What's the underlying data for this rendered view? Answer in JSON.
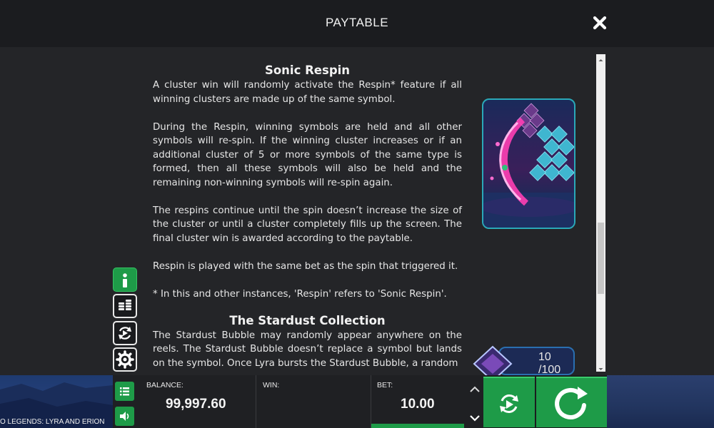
{
  "header": {
    "title": "PAYTABLE"
  },
  "paytable": {
    "section1": {
      "title": "Sonic Respin",
      "paragraphs": [
        "A cluster win will randomly activate the Respin* feature if all winning clusters are made up of the same symbol.",
        "During the Respin, winning symbols are held and all other symbols will re-spin. If the winning cluster increases or if an additional cluster of 5 or more symbols of the same type is formed, then all these symbols will also be held and the remaining non-winning symbols will re-spin again.",
        "The respins continue until the spin doesn’t increase the size of the cluster or until a cluster completely fills up the screen. The final cluster win is awarded according to the paytable.",
        "Respin is played with the same bet as the spin that triggered it.",
        "* In this and other instances, 'Respin' refers to 'Sonic Respin'."
      ]
    },
    "section2": {
      "title": "The Stardust Collection",
      "paragraphs": [
        "The Stardust Bubble may randomly appear anywhere on the reels. The Stardust Bubble doesn’t replace a symbol but lands on the symbol. Once Lyra bursts the Stardust Bubble, a random"
      ]
    },
    "counter": {
      "text": "10 /100"
    }
  },
  "side_menu": [
    {
      "name": "info",
      "icon": "info-icon",
      "active": true
    },
    {
      "name": "paytable",
      "icon": "coins-icon",
      "active": false
    },
    {
      "name": "autoplay",
      "icon": "autoplay-icon",
      "active": false
    },
    {
      "name": "settings",
      "icon": "gear-icon",
      "active": false
    }
  ],
  "bottom_bar": {
    "game_name": "O LEGENDS: LYRA AND ERION",
    "balance_label": "BALANCE:",
    "balance_value": "99,997.60",
    "win_label": "WIN:",
    "win_value": "",
    "bet_label": "BET:",
    "bet_value": "10.00"
  },
  "colors": {
    "accent_green": "#1e9b48",
    "panel_dark": "#242528",
    "header_dark": "#1b1c1f",
    "text": "#e6e6e6"
  }
}
